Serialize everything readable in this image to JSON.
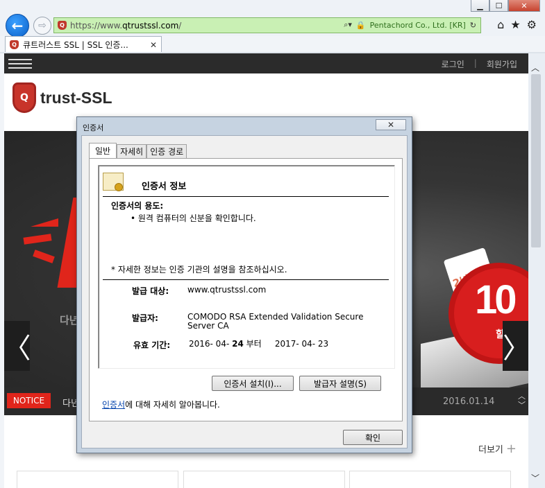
{
  "browser": {
    "url_prefix": "https://www.",
    "url_host": "qtrustssl.com",
    "url_suffix": "/",
    "cert_owner": "Pentachord Co., Ltd. [KR]",
    "tab_title": "큐트러스트 SSL | SSL 인증...",
    "window_min": "▁",
    "window_max": "☐",
    "window_close": "✕",
    "back_glyph": "←",
    "forward_glyph": "⇨",
    "home_glyph": "⌂",
    "favorites_glyph": "★",
    "settings_glyph": "⚙"
  },
  "site": {
    "login": "로그인",
    "signup": "회원가입",
    "separator": "|",
    "logo_letter": "Q",
    "logo_text": "trust-SSL",
    "banner_sub": "다년",
    "price_tag": "2년",
    "burst_number": "10",
    "burst_label": "할인",
    "arrow_left": "〈",
    "arrow_right": "〉",
    "notice_badge": "NOTICE",
    "notice_text": "다년",
    "notice_date": "2016.01.14",
    "more": "더보기",
    "more_plus": "+"
  },
  "dialog": {
    "title": "인증서",
    "close": "✕",
    "tabs": [
      "일반",
      "자세히",
      "인증 경로"
    ],
    "heading": "인증서 정보",
    "purpose_label": "인증서의 용도:",
    "purpose_item": "• 원격 컴퓨터의 신분을 확인합니다.",
    "ref_note": "* 자세한 정보는 인증 기관의 설명을 참조하십시오.",
    "issued_to_label": "발급 대상:",
    "issued_to_value": "www.qtrustssl.com",
    "issuer_label": "발급자:",
    "issuer_value_line1": "COMODO RSA Extended Validation Secure",
    "issuer_value_line2": "Server CA",
    "validity_label": "유효 기간:",
    "valid_from": "2016- 04- ",
    "valid_from_day": "24",
    "valid_to_word": "부터",
    "valid_to": "2017- 04- 23",
    "install_button": "인증서 설치(I)...",
    "issuer_statement_button": "발급자 설명(S)",
    "learn_link": "인증서",
    "learn_rest": "에 대해 자세히 알아봅니다.",
    "ok_button": "확인"
  },
  "scrollbar": {
    "up": "︿",
    "down": "﹀"
  }
}
